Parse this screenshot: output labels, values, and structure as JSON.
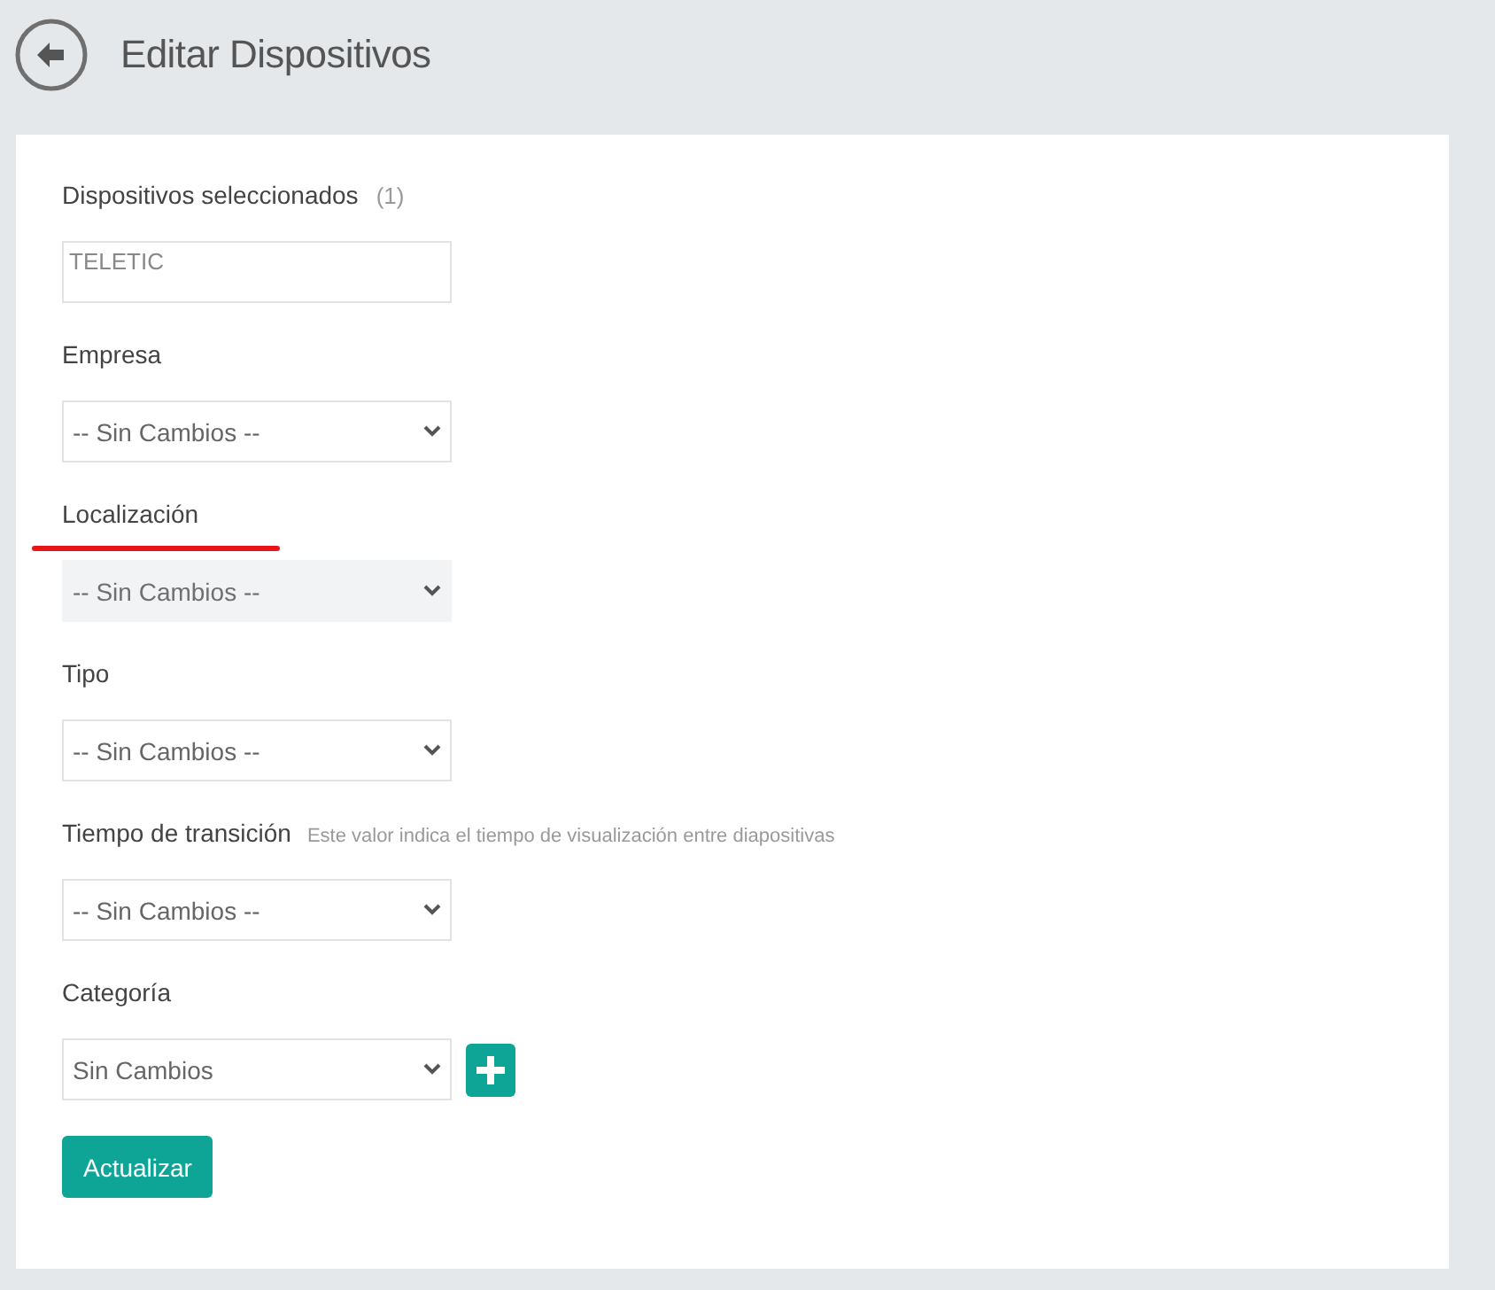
{
  "header": {
    "title": "Editar Dispositivos"
  },
  "fields": [
    {
      "kind": "list",
      "label": "Dispositivos seleccionados",
      "count": "(1)",
      "items": [
        "TELETIC"
      ],
      "highlighted": false
    },
    {
      "kind": "select",
      "label": "Empresa",
      "value": "-- Sin Cambios --",
      "disabled": false,
      "highlighted": false
    },
    {
      "kind": "select",
      "label": "Localización",
      "value": "-- Sin Cambios --",
      "disabled": true,
      "highlighted": true
    },
    {
      "kind": "select",
      "label": "Tipo",
      "value": "-- Sin Cambios --",
      "disabled": false,
      "highlighted": false
    },
    {
      "kind": "select",
      "label": "Tiempo de transición",
      "hint": "Este valor indica el tiempo de visualización entre diapositivas",
      "value": "-- Sin Cambios --",
      "disabled": false,
      "highlighted": false
    },
    {
      "kind": "select_add",
      "label": "Categoría",
      "value": "Sin Cambios",
      "disabled": false,
      "highlighted": false
    }
  ],
  "submit": "Actualizar"
}
